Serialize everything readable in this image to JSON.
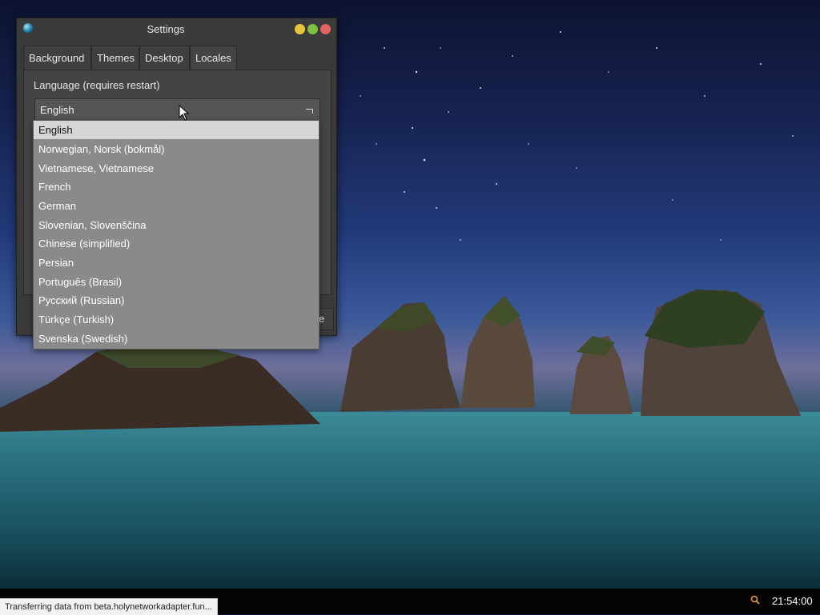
{
  "window": {
    "title": "Settings",
    "tabs": [
      "Background",
      "Themes",
      "Desktop",
      "Locales"
    ],
    "active_tab": "Locales"
  },
  "locales": {
    "language_label": "Language (requires restart)",
    "selected_language": "English",
    "bottom_button_partial": "e",
    "options": [
      "English",
      "Norwegian, Norsk (bokmål)",
      "Vietnamese, Vietnamese",
      "French",
      "German",
      "Slovenian, Slovenščina",
      "Chinese (simplified)",
      "Persian",
      "Português (Brasil)",
      "Русский (Russian)",
      "Türkçe (Turkish)",
      "Svenska (Swedish)"
    ]
  },
  "taskbar": {
    "status_text": "Transferring data from beta.holynetworkadapter.fun...",
    "clock": "21:54:00",
    "tray_icon": "search-icon"
  },
  "colors": {
    "window_bg": "#3a3a3a",
    "dropdown_bg": "#8a8a8a",
    "selected_item_bg": "#d6d6d6",
    "close_button": "#e06565",
    "minimize_button": "#e8c43c",
    "maximize_button": "#7fc040"
  }
}
